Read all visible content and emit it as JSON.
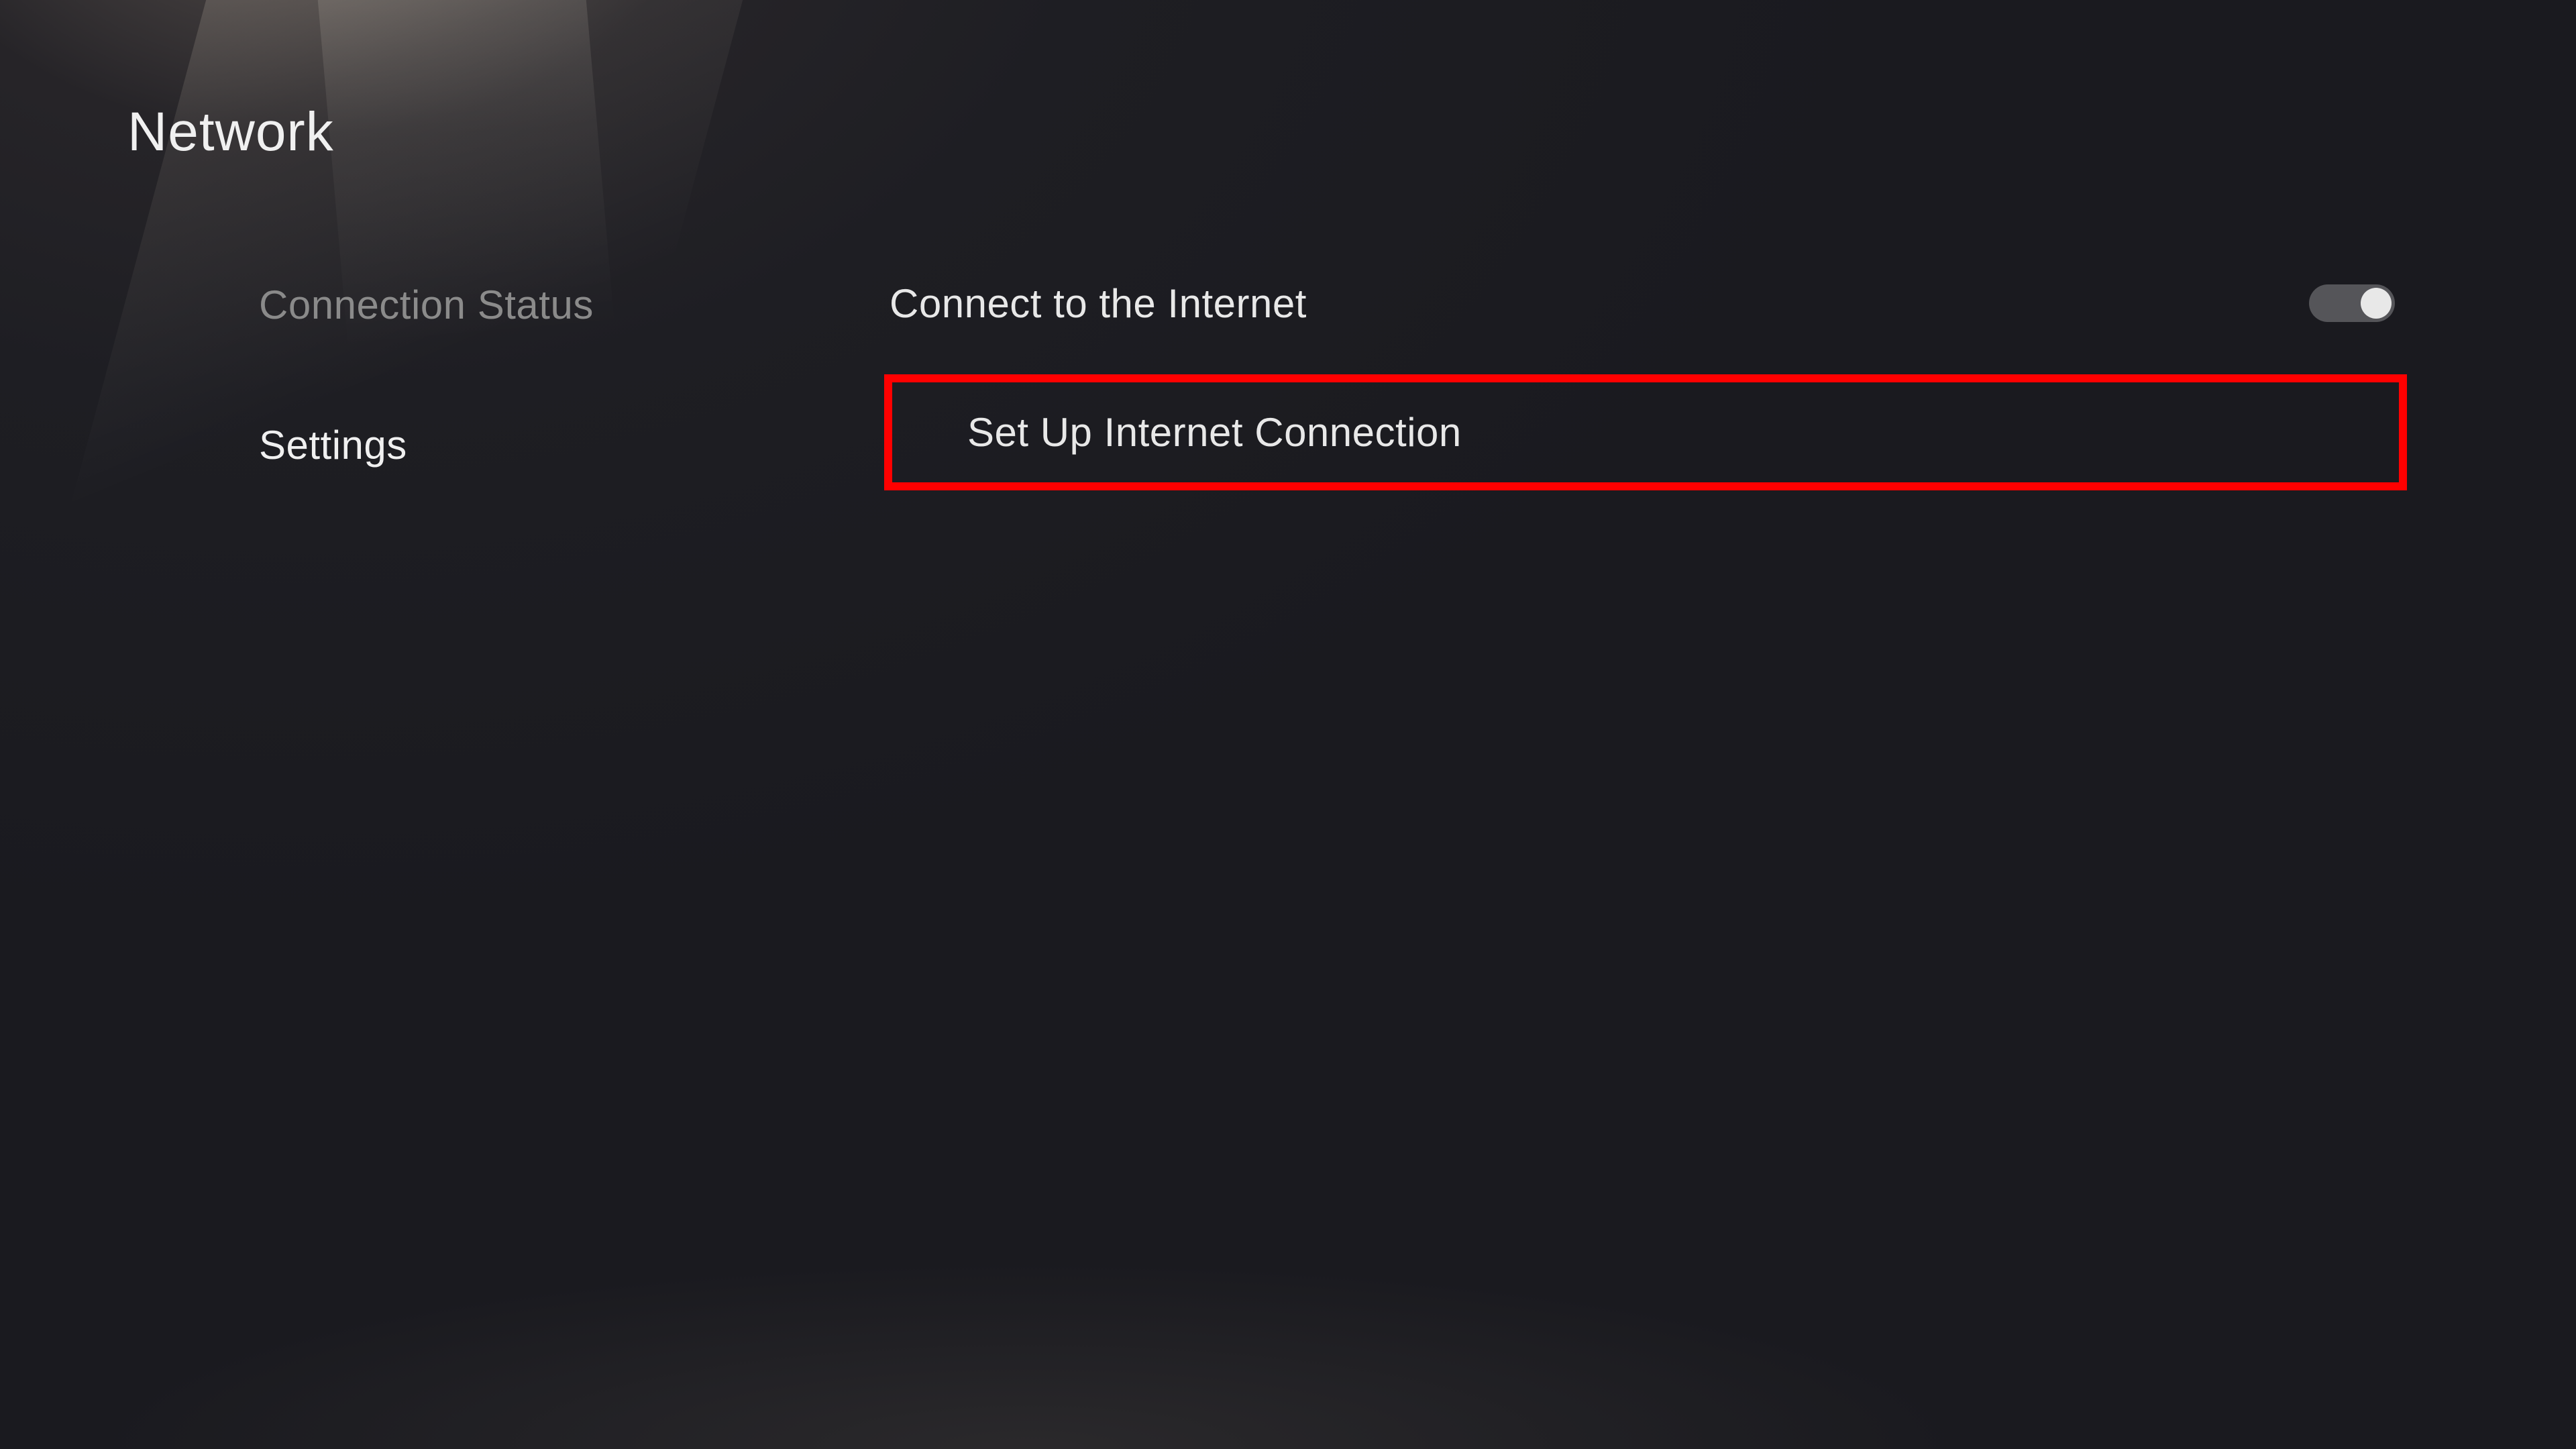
{
  "page_title": "Network",
  "sidebar": {
    "items": [
      {
        "label": "Connection Status",
        "active": false
      },
      {
        "label": "Settings",
        "active": true
      }
    ]
  },
  "content": {
    "connect_internet": {
      "label": "Connect to the Internet",
      "toggle_on": true
    },
    "setup_connection": {
      "label": "Set Up Internet Connection",
      "highlighted": true
    }
  }
}
